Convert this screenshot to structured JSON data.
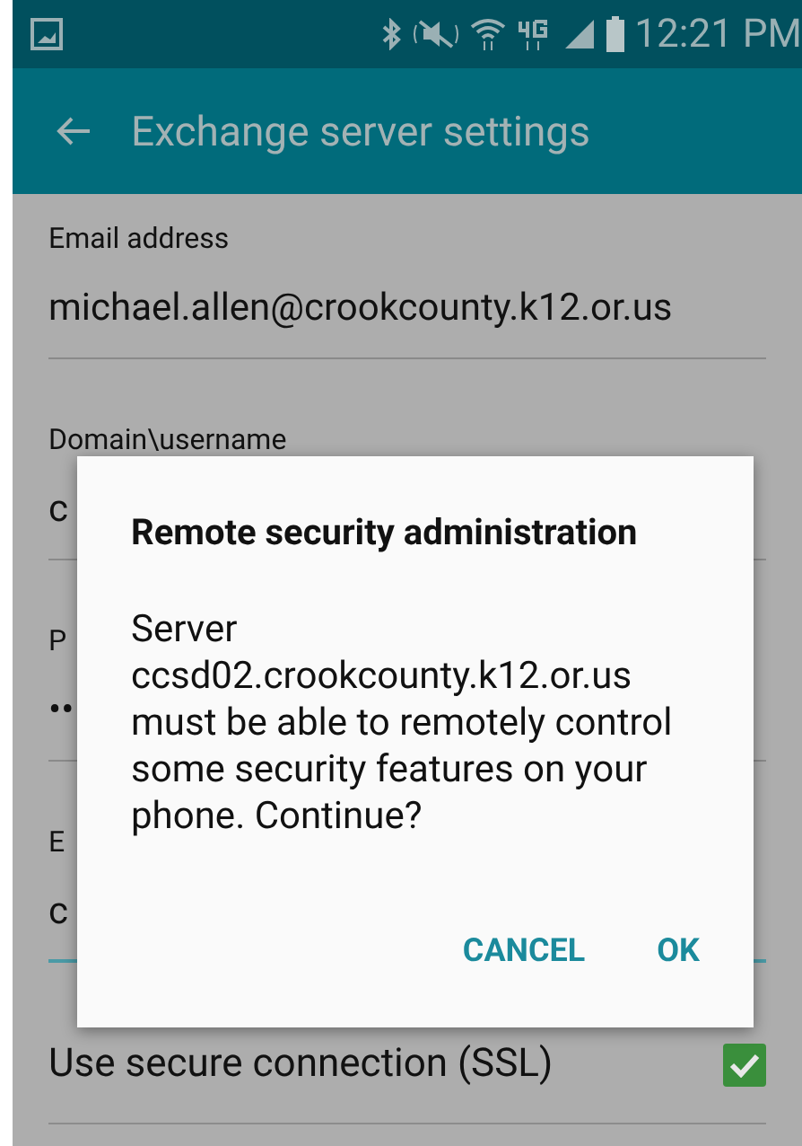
{
  "status_bar": {
    "time": "12:21 PM"
  },
  "app_bar": {
    "title": "Exchange server settings"
  },
  "fields": [
    {
      "label": "Email address",
      "value": "michael.allen@crookcounty.k12.or.us",
      "focused": false
    },
    {
      "label": "Domain\\username",
      "value": "c",
      "focused": false
    },
    {
      "label": "P",
      "value": "••",
      "focused": false
    },
    {
      "label": "E",
      "value": "c",
      "focused": true
    }
  ],
  "ssl": {
    "label": "Use secure connection (SSL)",
    "checked": true
  },
  "dialog": {
    "title": "Remote security administration",
    "message": "Server ccsd02.crookcounty.k12.or.us must be able to remotely control some security features on your phone. Continue?",
    "buttons": [
      "CANCEL",
      "OK"
    ]
  }
}
